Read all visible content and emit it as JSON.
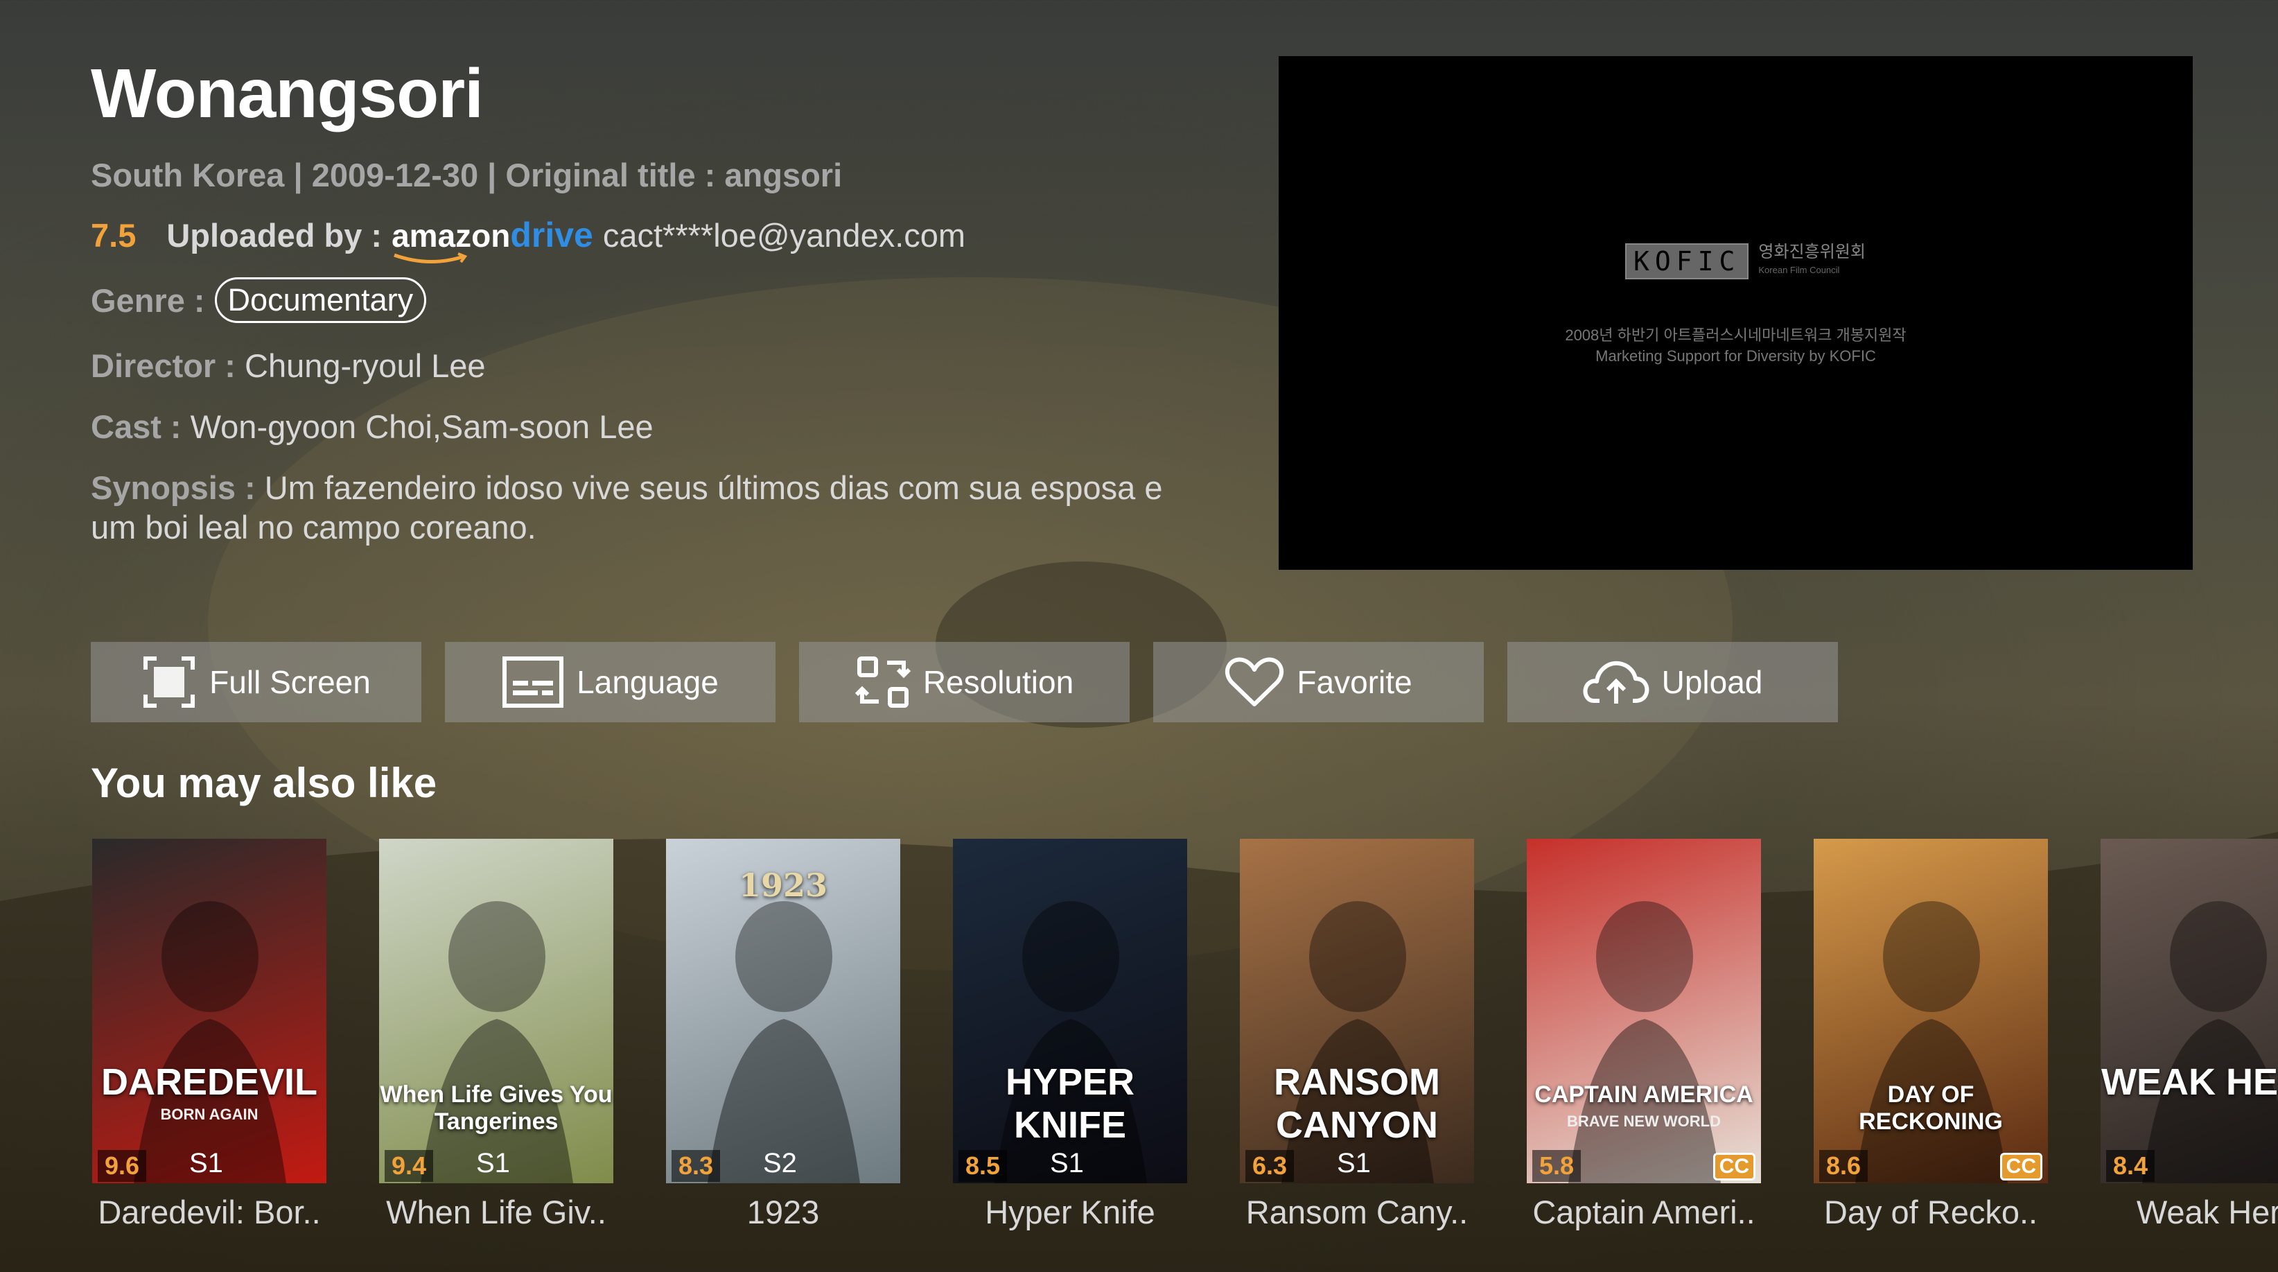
{
  "title": "Wonangsori",
  "meta": {
    "country": "South Korea",
    "date": "2009-12-30",
    "original_label": "Original title :",
    "original_title": "angsori"
  },
  "rating": "7.5",
  "uploaded": {
    "label": "Uploaded by :",
    "brand_amazon": "amazon",
    "brand_drive": "drive",
    "email": "cact****loe@yandex.com"
  },
  "genre": {
    "label": "Genre :",
    "value": "Documentary"
  },
  "director": {
    "label": "Director :",
    "value": "Chung-ryoul Lee"
  },
  "cast": {
    "label": "Cast :",
    "value": "Won-gyoon Choi,Sam-soon Lee"
  },
  "synopsis": {
    "label": "Synopsis :",
    "value": "Um fazendeiro idoso vive seus últimos dias com sua esposa e um boi leal no campo coreano."
  },
  "player": {
    "logo": "KOFIC",
    "logo_kr": "영화진흥위원회",
    "logo_en": "Korean Film Council",
    "line1": "2008년 하반기 아트플러스시네마네트워크 개봉지원작",
    "line2": "Marketing Support for Diversity by KOFIC"
  },
  "actions": [
    {
      "label": "Full Screen",
      "icon": "fullscreen-icon"
    },
    {
      "label": "Language",
      "icon": "subtitles-icon"
    },
    {
      "label": "Resolution",
      "icon": "resolution-icon"
    },
    {
      "label": "Favorite",
      "icon": "heart-icon"
    },
    {
      "label": "Upload",
      "icon": "cloud-upload-icon"
    }
  ],
  "section_title": "You may also like",
  "recommendations": [
    {
      "caption": "Daredevil: Bor..",
      "score": "9.6",
      "season": "S1",
      "cc": "",
      "poster_text": "DAREDEVIL",
      "poster_sub": "BORN AGAIN",
      "colors": [
        "#2a2a2a",
        "#c21a12"
      ]
    },
    {
      "caption": "When Life Giv..",
      "score": "9.4",
      "season": "S1",
      "cc": "",
      "poster_text": "When Life Gives You Tangerines",
      "poster_sub": "",
      "colors": [
        "#cfd6c8",
        "#7f8c4a"
      ]
    },
    {
      "caption": "1923",
      "score": "8.3",
      "season": "S2",
      "cc": "",
      "poster_text": "1923",
      "poster_sub": "",
      "colors": [
        "#c9d2d8",
        "#6d7a80"
      ]
    },
    {
      "caption": "Hyper Knife",
      "score": "8.5",
      "season": "S1",
      "cc": "",
      "poster_text": "HYPER KNIFE",
      "poster_sub": "",
      "colors": [
        "#1c2a3c",
        "#0c0c14"
      ]
    },
    {
      "caption": "Ransom Cany..",
      "score": "6.3",
      "season": "S1",
      "cc": "",
      "poster_text": "RANSOM CANYON",
      "poster_sub": "",
      "colors": [
        "#a77246",
        "#3b2a1e"
      ]
    },
    {
      "caption": "Captain Ameri..",
      "score": "5.8",
      "season": "",
      "cc": "CC",
      "poster_text": "CAPTAIN AMERICA",
      "poster_sub": "BRAVE NEW WORLD",
      "colors": [
        "#c6302a",
        "#e7e1d8"
      ]
    },
    {
      "caption": "Day of Recko..",
      "score": "8.6",
      "season": "",
      "cc": "CC",
      "poster_text": "DAY OF RECKONING",
      "poster_sub": "",
      "colors": [
        "#d69a4a",
        "#5a2a12"
      ]
    },
    {
      "caption": "Weak Hero",
      "score": "8.4",
      "season": "",
      "cc": "",
      "poster_text": "WEAK HERO",
      "poster_sub": "",
      "colors": [
        "#6a5a52",
        "#2a2422"
      ]
    }
  ]
}
